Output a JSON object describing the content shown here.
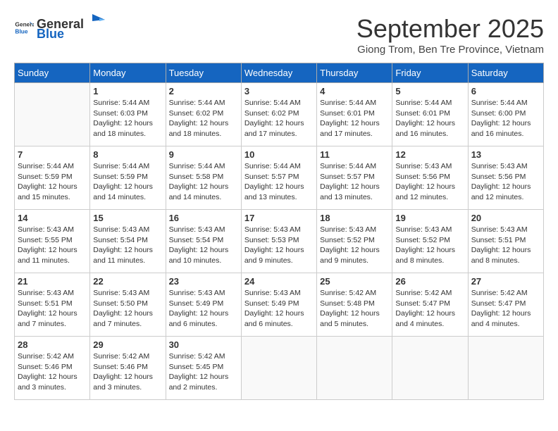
{
  "header": {
    "logo_general": "General",
    "logo_blue": "Blue",
    "month_title": "September 2025",
    "location": "Giong Trom, Ben Tre Province, Vietnam"
  },
  "calendar": {
    "days_of_week": [
      "Sunday",
      "Monday",
      "Tuesday",
      "Wednesday",
      "Thursday",
      "Friday",
      "Saturday"
    ],
    "weeks": [
      [
        {
          "day": "",
          "info": ""
        },
        {
          "day": "1",
          "info": "Sunrise: 5:44 AM\nSunset: 6:03 PM\nDaylight: 12 hours\nand 18 minutes."
        },
        {
          "day": "2",
          "info": "Sunrise: 5:44 AM\nSunset: 6:02 PM\nDaylight: 12 hours\nand 18 minutes."
        },
        {
          "day": "3",
          "info": "Sunrise: 5:44 AM\nSunset: 6:02 PM\nDaylight: 12 hours\nand 17 minutes."
        },
        {
          "day": "4",
          "info": "Sunrise: 5:44 AM\nSunset: 6:01 PM\nDaylight: 12 hours\nand 17 minutes."
        },
        {
          "day": "5",
          "info": "Sunrise: 5:44 AM\nSunset: 6:01 PM\nDaylight: 12 hours\nand 16 minutes."
        },
        {
          "day": "6",
          "info": "Sunrise: 5:44 AM\nSunset: 6:00 PM\nDaylight: 12 hours\nand 16 minutes."
        }
      ],
      [
        {
          "day": "7",
          "info": "Sunrise: 5:44 AM\nSunset: 5:59 PM\nDaylight: 12 hours\nand 15 minutes."
        },
        {
          "day": "8",
          "info": "Sunrise: 5:44 AM\nSunset: 5:59 PM\nDaylight: 12 hours\nand 14 minutes."
        },
        {
          "day": "9",
          "info": "Sunrise: 5:44 AM\nSunset: 5:58 PM\nDaylight: 12 hours\nand 14 minutes."
        },
        {
          "day": "10",
          "info": "Sunrise: 5:44 AM\nSunset: 5:57 PM\nDaylight: 12 hours\nand 13 minutes."
        },
        {
          "day": "11",
          "info": "Sunrise: 5:44 AM\nSunset: 5:57 PM\nDaylight: 12 hours\nand 13 minutes."
        },
        {
          "day": "12",
          "info": "Sunrise: 5:43 AM\nSunset: 5:56 PM\nDaylight: 12 hours\nand 12 minutes."
        },
        {
          "day": "13",
          "info": "Sunrise: 5:43 AM\nSunset: 5:56 PM\nDaylight: 12 hours\nand 12 minutes."
        }
      ],
      [
        {
          "day": "14",
          "info": "Sunrise: 5:43 AM\nSunset: 5:55 PM\nDaylight: 12 hours\nand 11 minutes."
        },
        {
          "day": "15",
          "info": "Sunrise: 5:43 AM\nSunset: 5:54 PM\nDaylight: 12 hours\nand 11 minutes."
        },
        {
          "day": "16",
          "info": "Sunrise: 5:43 AM\nSunset: 5:54 PM\nDaylight: 12 hours\nand 10 minutes."
        },
        {
          "day": "17",
          "info": "Sunrise: 5:43 AM\nSunset: 5:53 PM\nDaylight: 12 hours\nand 9 minutes."
        },
        {
          "day": "18",
          "info": "Sunrise: 5:43 AM\nSunset: 5:52 PM\nDaylight: 12 hours\nand 9 minutes."
        },
        {
          "day": "19",
          "info": "Sunrise: 5:43 AM\nSunset: 5:52 PM\nDaylight: 12 hours\nand 8 minutes."
        },
        {
          "day": "20",
          "info": "Sunrise: 5:43 AM\nSunset: 5:51 PM\nDaylight: 12 hours\nand 8 minutes."
        }
      ],
      [
        {
          "day": "21",
          "info": "Sunrise: 5:43 AM\nSunset: 5:51 PM\nDaylight: 12 hours\nand 7 minutes."
        },
        {
          "day": "22",
          "info": "Sunrise: 5:43 AM\nSunset: 5:50 PM\nDaylight: 12 hours\nand 7 minutes."
        },
        {
          "day": "23",
          "info": "Sunrise: 5:43 AM\nSunset: 5:49 PM\nDaylight: 12 hours\nand 6 minutes."
        },
        {
          "day": "24",
          "info": "Sunrise: 5:43 AM\nSunset: 5:49 PM\nDaylight: 12 hours\nand 6 minutes."
        },
        {
          "day": "25",
          "info": "Sunrise: 5:42 AM\nSunset: 5:48 PM\nDaylight: 12 hours\nand 5 minutes."
        },
        {
          "day": "26",
          "info": "Sunrise: 5:42 AM\nSunset: 5:47 PM\nDaylight: 12 hours\nand 4 minutes."
        },
        {
          "day": "27",
          "info": "Sunrise: 5:42 AM\nSunset: 5:47 PM\nDaylight: 12 hours\nand 4 minutes."
        }
      ],
      [
        {
          "day": "28",
          "info": "Sunrise: 5:42 AM\nSunset: 5:46 PM\nDaylight: 12 hours\nand 3 minutes."
        },
        {
          "day": "29",
          "info": "Sunrise: 5:42 AM\nSunset: 5:46 PM\nDaylight: 12 hours\nand 3 minutes."
        },
        {
          "day": "30",
          "info": "Sunrise: 5:42 AM\nSunset: 5:45 PM\nDaylight: 12 hours\nand 2 minutes."
        },
        {
          "day": "",
          "info": ""
        },
        {
          "day": "",
          "info": ""
        },
        {
          "day": "",
          "info": ""
        },
        {
          "day": "",
          "info": ""
        }
      ]
    ]
  }
}
